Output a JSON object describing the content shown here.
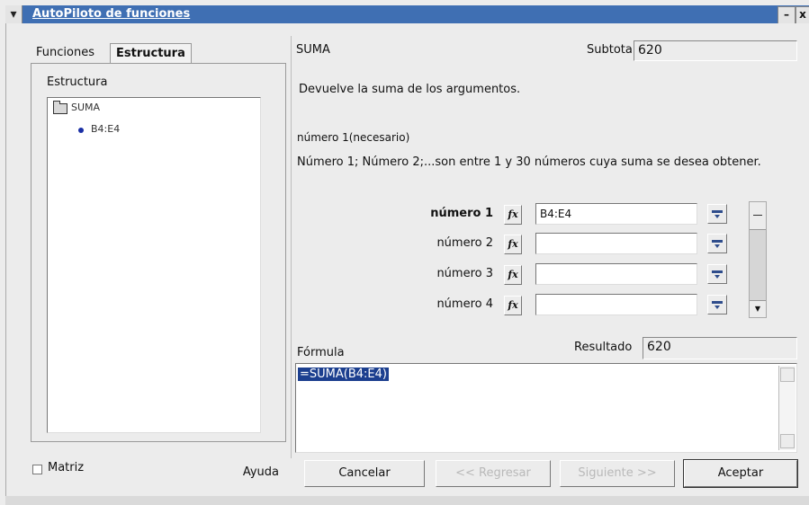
{
  "window": {
    "title": "AutoPiloto de funciones",
    "menu_glyph": "▾",
    "minimize_glyph": "–",
    "close_glyph": "x"
  },
  "tabs": [
    {
      "label": "Funciones"
    },
    {
      "label": "Estructura"
    }
  ],
  "structure": {
    "group_label": "Estructura",
    "tree": [
      {
        "label": "SUMA",
        "icon": "folder-icon"
      },
      {
        "label": "B4:E4",
        "icon": "bullet-icon"
      }
    ]
  },
  "function": {
    "name": "SUMA",
    "subtotal_label": "Subtotal",
    "subtotal_value": "620",
    "description": "Devuelve la suma de los argumentos.",
    "arg_name": "número 1(necesario)",
    "arg_description": "Número 1; Número 2;...son entre 1 y 30 números cuya suma se desea obtener."
  },
  "arguments": [
    {
      "label": "número 1",
      "value": "B4:E4"
    },
    {
      "label": "número 2",
      "value": ""
    },
    {
      "label": "número 3",
      "value": ""
    },
    {
      "label": "número 4",
      "value": ""
    }
  ],
  "fx_glyph": "fx",
  "formula": {
    "label": "Fórmula",
    "text": "=SUMA(B4:E4)",
    "result_label": "Resultado",
    "result_value": "620"
  },
  "footer": {
    "matrix_label": "Matriz",
    "help": "Ayuda",
    "cancel": "Cancelar",
    "back": "<< Regresar",
    "next": "Siguiente >>",
    "ok": "Aceptar"
  },
  "colors": {
    "titlebar": "#3f6fb3",
    "selection": "#1c3f8f"
  }
}
